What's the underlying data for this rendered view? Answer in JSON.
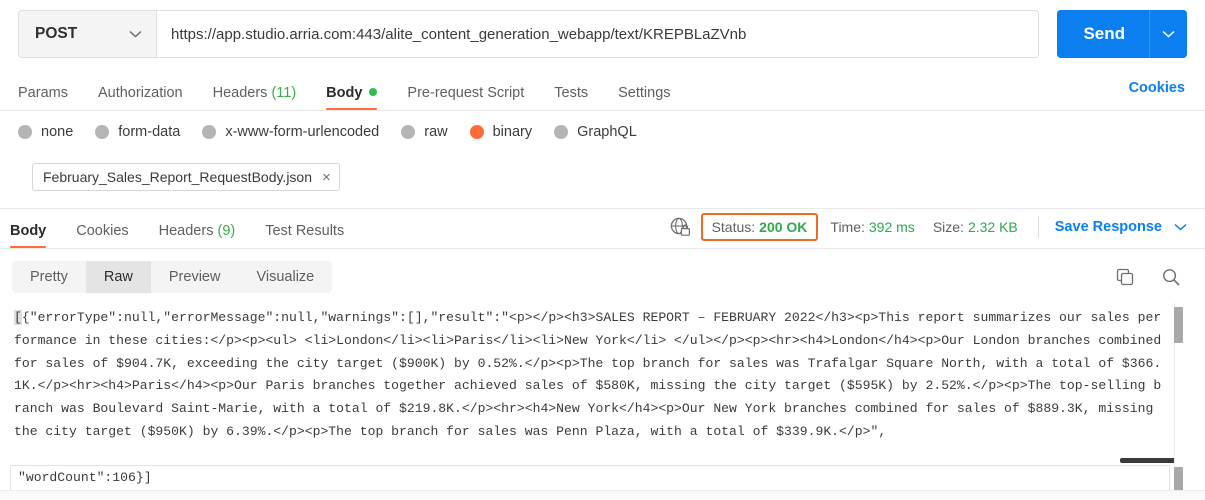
{
  "request": {
    "method": "POST",
    "url": "https://app.studio.arria.com:443/alite_content_generation_webapp/text/KREPBLaZVnb",
    "send_label": "Send",
    "cookies_label": "Cookies",
    "tabs": [
      {
        "label": "Params",
        "count": "",
        "active": false,
        "dot": false
      },
      {
        "label": "Authorization",
        "count": "",
        "active": false,
        "dot": false
      },
      {
        "label": "Headers",
        "count": "(11)",
        "active": false,
        "dot": false
      },
      {
        "label": "Body",
        "count": "",
        "active": true,
        "dot": true
      },
      {
        "label": "Pre-request Script",
        "count": "",
        "active": false,
        "dot": false
      },
      {
        "label": "Tests",
        "count": "",
        "active": false,
        "dot": false
      },
      {
        "label": "Settings",
        "count": "",
        "active": false,
        "dot": false
      }
    ],
    "body_types": [
      {
        "label": "none",
        "selected": false
      },
      {
        "label": "form-data",
        "selected": false
      },
      {
        "label": "x-www-form-urlencoded",
        "selected": false
      },
      {
        "label": "raw",
        "selected": false
      },
      {
        "label": "binary",
        "selected": true
      },
      {
        "label": "GraphQL",
        "selected": false
      }
    ],
    "file_name": "February_Sales_Report_RequestBody.json",
    "file_remove": "×"
  },
  "response": {
    "tabs": [
      {
        "label": "Body",
        "count": "",
        "active": true
      },
      {
        "label": "Cookies",
        "count": "",
        "active": false
      },
      {
        "label": "Headers",
        "count": "(9)",
        "active": false
      },
      {
        "label": "Test Results",
        "count": "",
        "active": false
      }
    ],
    "status_label": "Status:",
    "status_value": "200 OK",
    "time_label": "Time:",
    "time_value": "392 ms",
    "size_label": "Size:",
    "size_value": "2.32 KB",
    "save_response": "Save Response",
    "view_modes": [
      {
        "label": "Pretty",
        "selected": false
      },
      {
        "label": "Raw",
        "selected": true
      },
      {
        "label": "Preview",
        "selected": false
      },
      {
        "label": "Visualize",
        "selected": false
      }
    ],
    "body_prefix": "[",
    "body_text": "{\"errorType\":null,\"errorMessage\":null,\"warnings\":[],\"result\":\"<p></p><h3>SALES REPORT – FEBRUARY 2022</h3><p>This report summarizes our sales performance in these cities:</p><p><ul> <li>London</li><li>Paris</li><li>New York</li> </ul></p><p><hr><h4>London</h4><p>Our London branches combined for sales of $904.7K, exceeding the city target ($900K) by 0.52%.</p><p>The top branch for sales was Trafalgar Square North, with a total of $366.1K.</p><hr><h4>Paris</h4><p>Our Paris branches together achieved sales of $580K, missing the city target ($595K) by 2.52%.</p><p>The top-selling branch was Boulevard Saint-Marie, with a total of $219.8K.</p><hr><h4>New York</h4><p>Our New York branches combined for sales of $889.3K, missing the city target ($950K) by 6.39%.</p><p>The top branch for sales was Penn Plaza, with a total of $339.9K.</p>\",",
    "body_lastline": "\"wordCount\":106}]"
  },
  "colors": {
    "accent_orange": "#ff6c37",
    "link_blue": "#0b7ff0",
    "status_green": "#2fa84f",
    "status_box_border": "#f26a21"
  },
  "icons": {
    "method_chevron": "∨",
    "send_chevron": "∨",
    "save_chevron": "∨"
  }
}
